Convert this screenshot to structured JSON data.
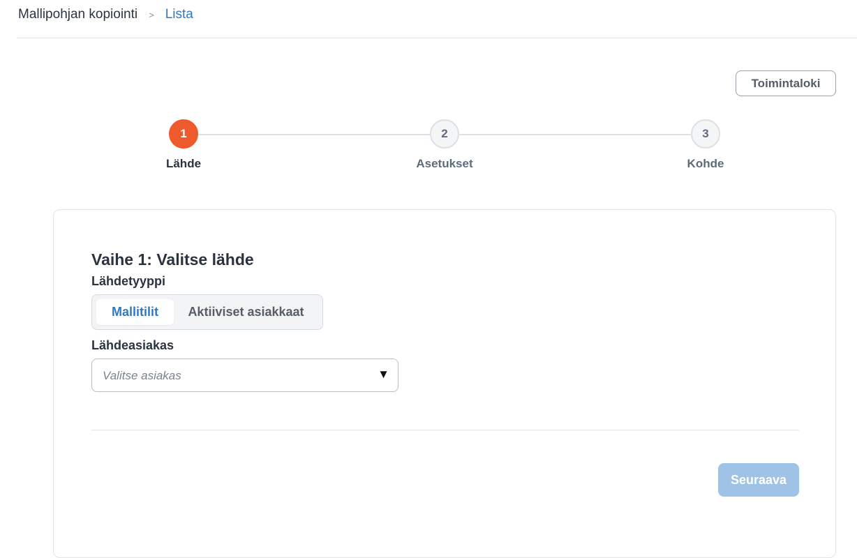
{
  "breadcrumb": {
    "root": "Mallipohjan kopiointi",
    "separator": ">",
    "current": "Lista"
  },
  "toolbar": {
    "log_label": "Toimintaloki"
  },
  "stepper": {
    "current_step": 1,
    "steps": [
      {
        "number": "1",
        "label": "Lähde",
        "state": "active"
      },
      {
        "number": "2",
        "label": "Asetukset",
        "state": "inactive"
      },
      {
        "number": "3",
        "label": "Kohde",
        "state": "inactive"
      }
    ]
  },
  "form": {
    "title": "Vaihe 1: Valitse lähde",
    "source_type": {
      "label": "Lähdetyyppi",
      "options": [
        "Mallitilit",
        "Aktiiviset asiakkaat"
      ],
      "selected": "Mallitilit"
    },
    "source_client": {
      "label": "Lähdeasiakas",
      "placeholder": "Valitse asiakas",
      "caret_icon": "caret-down-icon"
    },
    "next_label": "Seuraava"
  },
  "colors": {
    "accent": "#2f78c4",
    "active_step": "#ee5a2c",
    "next_disabled": "#9fc3e6"
  }
}
